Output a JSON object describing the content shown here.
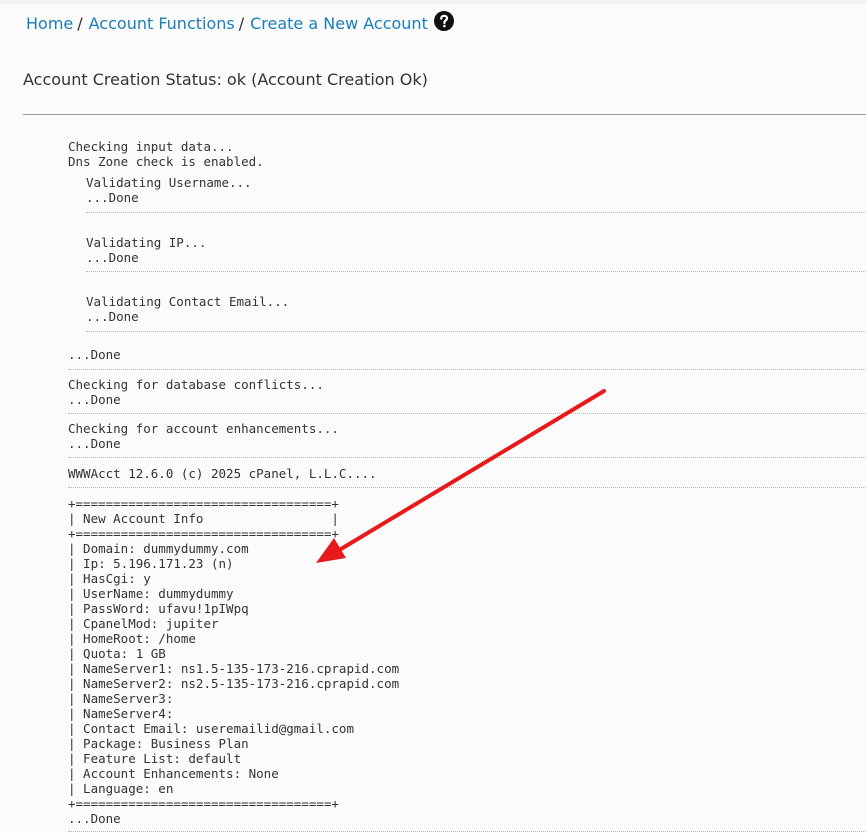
{
  "breadcrumb": {
    "home": "Home",
    "account_functions": "Account Functions",
    "current": "Create a New Account",
    "separator": "/"
  },
  "status": {
    "text": "Account Creation Status: ok (Account Creation Ok)"
  },
  "log": {
    "checking_input": "Checking input data...",
    "dns_zone": "Dns Zone check is enabled.",
    "validate_username": "Validating Username...",
    "validate_username_done": "...Done",
    "validate_ip": "Validating IP...",
    "validate_ip_done": "...Done",
    "validate_email": "Validating Contact Email...",
    "validate_email_done": "...Done",
    "input_done": "...Done",
    "db_conflicts": "Checking for database conflicts...",
    "db_conflicts_done": "...Done",
    "enhancements": "Checking for account enhancements...",
    "enhancements_done": "...Done",
    "wwwacct": "WWWAcct 12.6.0 (c) 2025 cPanel, L.L.C....",
    "final_done": "...Done"
  },
  "account_info": {
    "border": "+==================================+",
    "header": "| New Account Info                 |",
    "lines": [
      "| Domain: dummydummy.com",
      "| Ip: 5.196.171.23 (n)",
      "| HasCgi: y",
      "| UserName: dummydummy",
      "| PassWord: ufavu!1pIWpq",
      "| CpanelMod: jupiter",
      "| HomeRoot: /home",
      "| Quota: 1 GB",
      "| NameServer1: ns1.5-135-173-216.cprapid.com",
      "| NameServer2: ns2.5-135-173-216.cprapid.com",
      "| NameServer3:",
      "| NameServer4:",
      "| Contact Email: useremailid@gmail.com",
      "| Package: Business Plan",
      "| Feature List: default",
      "| Account Enhancements: None",
      "| Language: en"
    ]
  },
  "colors": {
    "link": "#1a7fb8",
    "annotation_arrow": "#e8191b",
    "text": "#333333"
  },
  "icons": {
    "help": "question-circle-icon",
    "annotation": "red-arrow-annotation"
  }
}
